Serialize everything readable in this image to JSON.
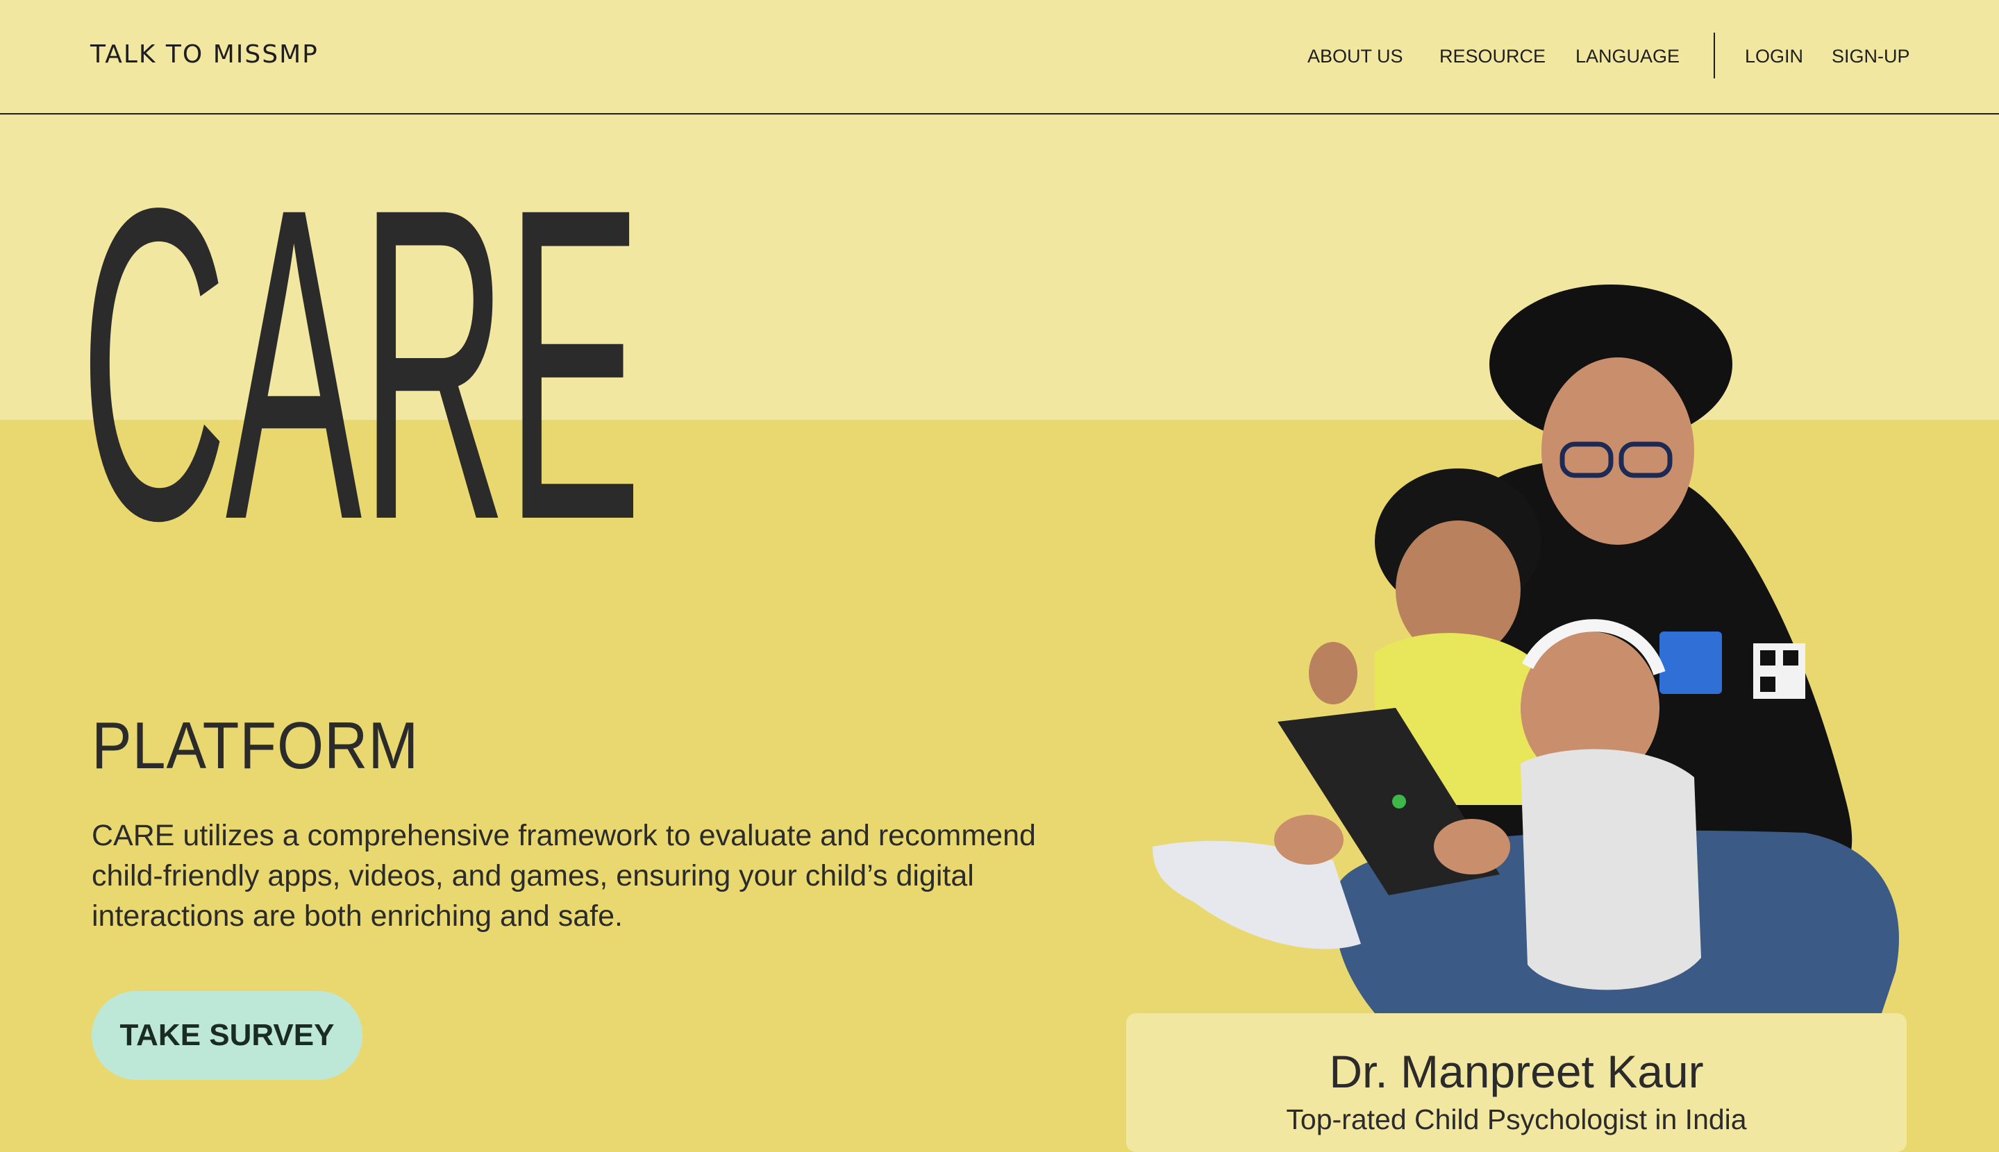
{
  "header": {
    "logo": "TALK TO MISSMP",
    "nav": [
      "ABOUT US",
      "RESOURCE",
      "LANGUAGE"
    ],
    "auth": [
      "LOGIN",
      "SIGN-UP"
    ]
  },
  "hero": {
    "title": "CARE",
    "subtitle": "PLATFORM",
    "description": "CARE utilizes a comprehensive framework to evaluate and recommend child-friendly apps, videos, and games, ensuring your child’s digital interactions are both enriching and safe.",
    "cta_label": "TAKE SURVEY"
  },
  "profile": {
    "name": "Dr. Manpreet Kaur",
    "role": "Top-rated Child Psychologist in India",
    "photo_icon": "person-with-children-photo"
  },
  "colors": {
    "top_band": "#f2e7a1",
    "main_background": "#e9d870",
    "cta_background": "#bde8d8",
    "text": "#2b2b2b"
  }
}
